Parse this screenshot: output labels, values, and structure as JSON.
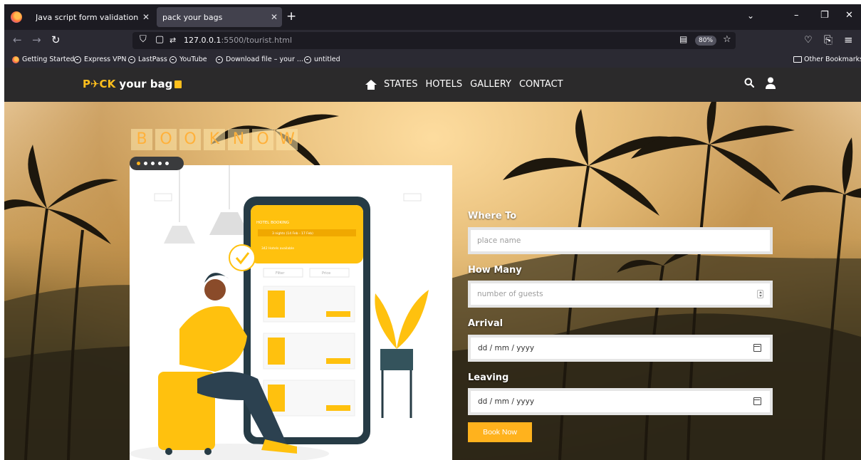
{
  "browser": {
    "tabs": [
      {
        "title": "Java script form validation",
        "active": false
      },
      {
        "title": "pack your bags",
        "active": true
      }
    ],
    "url": {
      "host": "127.0.0.1",
      "path": ":5500/tourist.html"
    },
    "zoom": "80%",
    "bookmarks": [
      "Getting Started",
      "Express VPN",
      "LastPass",
      "YouTube",
      "Download file – your ...",
      "untitled"
    ],
    "other_bookmarks": "Other Bookmarks"
  },
  "site": {
    "logo": {
      "brand": "P✈CK",
      "rest": " your bag"
    },
    "nav": [
      "STATES",
      "HOTELS",
      "GALLERY",
      "CONTACT"
    ],
    "accent": "#ffb21d"
  },
  "hero": {
    "title_letters": [
      "B",
      "O",
      "O",
      "K",
      "N",
      "O",
      "W"
    ],
    "slides_count": 5,
    "active_slide": 1
  },
  "illustration": {
    "header": "HOTEL BOOKING",
    "nights": "3 nights (14 Feb - 17 Feb)",
    "available": "342 Hotels available",
    "filter": "Filter",
    "price": "Price"
  },
  "form": {
    "where_label": "Where To",
    "where_placeholder": "place name",
    "how_many_label": "How Many",
    "guests_placeholder": "number of guests",
    "arrival_label": "Arrival",
    "arrival_value": "dd / mm / yyyy",
    "leaving_label": "Leaving",
    "leaving_value": "dd / mm / yyyy",
    "submit_label": "Book Now"
  }
}
